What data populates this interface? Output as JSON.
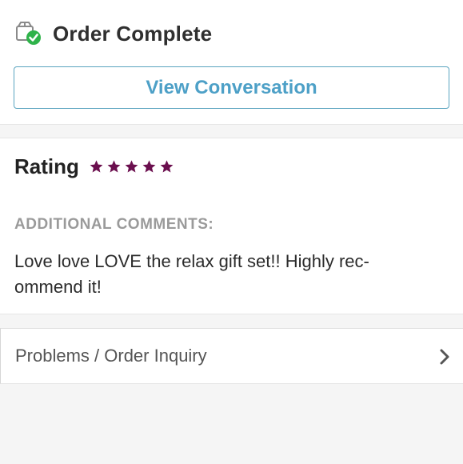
{
  "order": {
    "status_title": "Order Complete",
    "status_icon": "box-check-icon",
    "view_conversation_label": "View Conversation"
  },
  "rating": {
    "label": "Rating",
    "stars": 5,
    "max_stars": 5,
    "star_color": "#6b0f4e",
    "comments_label": "ADDITIONAL COMMENTS:",
    "comments_text": "Love love LOVE the relax gift set!! Highly rec- ommend it!"
  },
  "problems": {
    "label": "Problems / Order Inquiry",
    "icon": "chevron-right-icon"
  },
  "colors": {
    "accent": "#4da0c7",
    "success": "#2fb34a"
  }
}
